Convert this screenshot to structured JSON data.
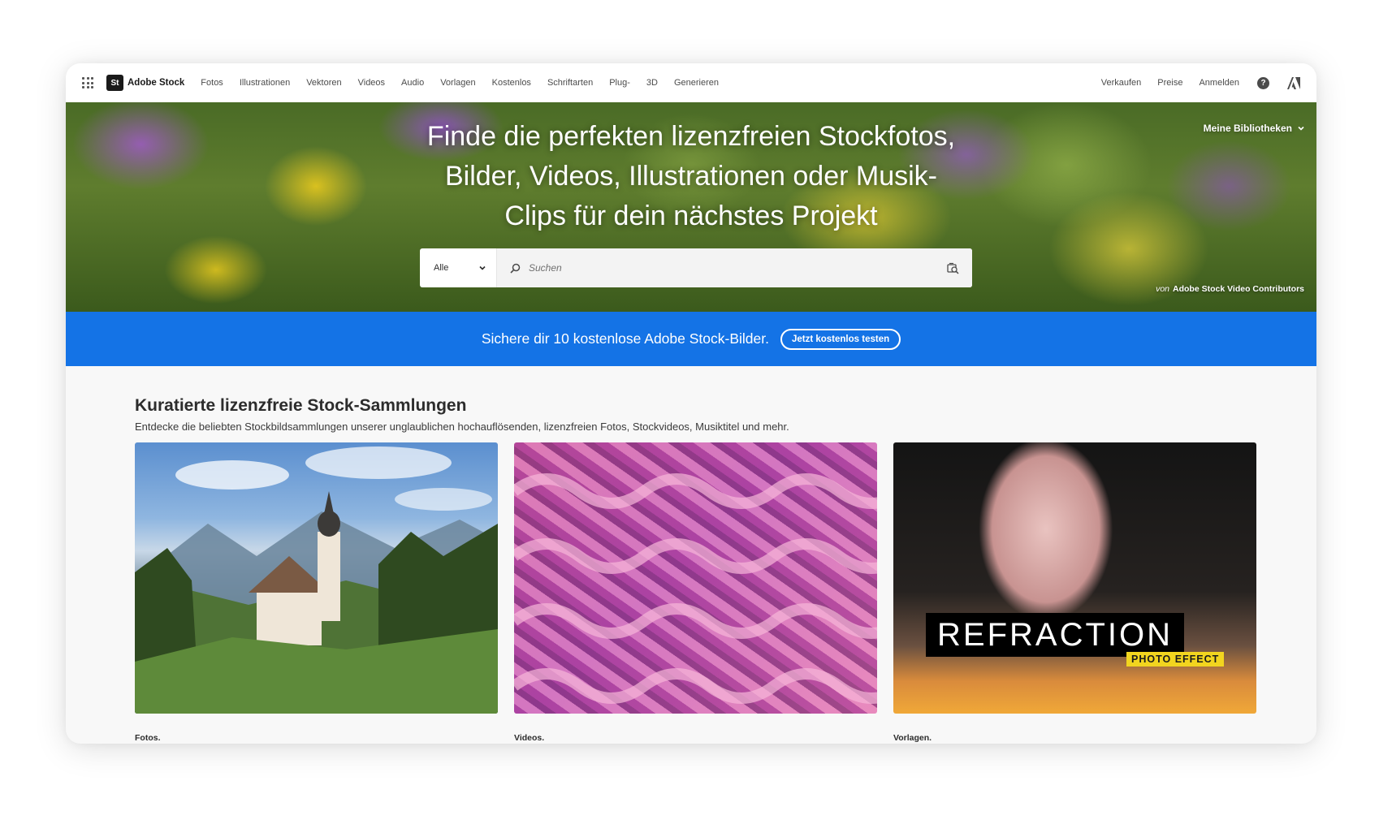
{
  "header": {
    "logo_mark": "St",
    "brand": "Adobe Stock",
    "nav": [
      "Fotos",
      "Illustrationen",
      "Vektoren",
      "Videos",
      "Audio",
      "Vorlagen",
      "Kostenlos",
      "Schriftarten",
      "Plug-",
      "3D",
      "Generieren"
    ],
    "right": [
      "Verkaufen",
      "Preise",
      "Anmelden"
    ],
    "help_glyph": "?"
  },
  "hero": {
    "title": "Finde die perfekten lizenzfreien Stockfotos,\nBilder, Videos, Illustrationen oder Musik-\nClips für dein nächstes Projekt",
    "libraries": "Meine Bibliotheken",
    "search": {
      "type": "Alle",
      "placeholder": "Suchen"
    },
    "credit_prefix": "von",
    "credit_name": "Adobe Stock Video Contributors"
  },
  "banner": {
    "text": "Sichere dir 10 kostenlose Adobe Stock-Bilder.",
    "button": "Jetzt kostenlos testen"
  },
  "collections": {
    "title": "Kuratierte lizenzfreie Stock-Sammlungen",
    "subtitle": "Entdecke die beliebten Stockbildsammlungen unserer unglaublichen hochauflösenden, lizenzfreien Fotos, Stockvideos, Musiktitel und mehr.",
    "items": [
      {
        "label": "Fotos."
      },
      {
        "label": "Videos."
      },
      {
        "label": "Vorlagen.",
        "overlay_title": "REFRACTION",
        "overlay_sub": "PHOTO EFFECT"
      }
    ]
  },
  "colors": {
    "accent": "#1473e6",
    "overlay_yellow": "#f2d51f"
  }
}
